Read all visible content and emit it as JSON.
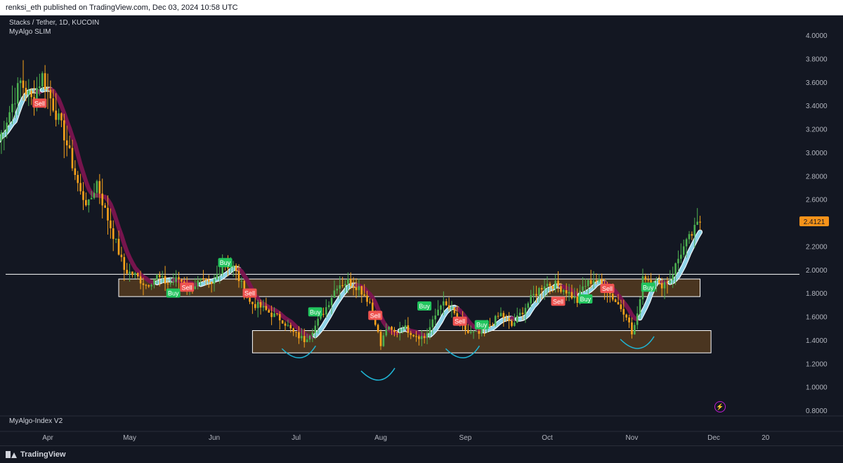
{
  "header": {
    "publisher_text": "renksi_eth published on TradingView.com, Dec 03, 2024 10:58 UTC"
  },
  "legend": {
    "symbol": "Stacks / Tether, 1D, KUCOIN",
    "indicator1": "MyAlgo SLIM",
    "indicator2": "MyAlgo-Index V2"
  },
  "footer": {
    "brand": "TradingView"
  },
  "icons": {
    "alert": "bolt-icon",
    "logo": "tradingview-logo-icon"
  },
  "colors": {
    "background": "#131722",
    "bull_candle": "#4caf50",
    "bear_candle": "#f7a21b",
    "up_band": "#8fd3e8",
    "down_band": "#7b1450",
    "zone_fill": "#4a3520",
    "zone_border": "#ffffff",
    "buy_label": "#22c55e",
    "sell_label": "#ef5350",
    "price_tag": "#f7931a",
    "hand_curves": "#1fb6d6"
  },
  "chart_data": {
    "type": "candlestick",
    "y_ticks": [
      "4.0000",
      "3.8000",
      "3.6000",
      "3.4000",
      "3.2000",
      "3.0000",
      "2.8000",
      "2.6000",
      "2.4000",
      "2.2000",
      "2.0000",
      "1.8000",
      "1.6000",
      "1.4000",
      "1.2000",
      "1.0000",
      "0.8000"
    ],
    "ylim": [
      0.8,
      4.0
    ],
    "x_ticks": [
      {
        "label": "Apr",
        "day": 18
      },
      {
        "label": "May",
        "day": 48
      },
      {
        "label": "Jun",
        "day": 79
      },
      {
        "label": "Jul",
        "day": 109
      },
      {
        "label": "Aug",
        "day": 140
      },
      {
        "label": "Sep",
        "day": 171
      },
      {
        "label": "Oct",
        "day": 201
      },
      {
        "label": "Nov",
        "day": 232
      },
      {
        "label": "Dec",
        "day": 262
      },
      {
        "label": "20",
        "day": 281
      }
    ],
    "last_price": "2.4121",
    "horizontal_line": 1.96,
    "zones": [
      {
        "from_day": 44,
        "to_day": 257,
        "low": 1.77,
        "high": 1.92
      },
      {
        "from_day": 93,
        "to_day": 261,
        "low": 1.29,
        "high": 1.48
      }
    ],
    "price_path": [
      [
        0,
        3.1
      ],
      [
        4,
        3.35
      ],
      [
        8,
        3.6
      ],
      [
        12,
        3.45
      ],
      [
        16,
        3.65
      ],
      [
        20,
        3.4
      ],
      [
        24,
        3.15
      ],
      [
        27,
        2.9
      ],
      [
        30,
        2.65
      ],
      [
        33,
        2.55
      ],
      [
        36,
        2.75
      ],
      [
        39,
        2.5
      ],
      [
        42,
        2.3
      ],
      [
        46,
        2.0
      ],
      [
        50,
        1.95
      ],
      [
        54,
        1.87
      ],
      [
        58,
        1.94
      ],
      [
        62,
        1.88
      ],
      [
        66,
        1.92
      ],
      [
        70,
        1.85
      ],
      [
        74,
        1.9
      ],
      [
        78,
        1.86
      ],
      [
        82,
        2.05
      ],
      [
        86,
        2.02
      ],
      [
        89,
        1.87
      ],
      [
        92,
        1.72
      ],
      [
        96,
        1.68
      ],
      [
        100,
        1.62
      ],
      [
        104,
        1.57
      ],
      [
        108,
        1.46
      ],
      [
        112,
        1.4
      ],
      [
        116,
        1.52
      ],
      [
        120,
        1.68
      ],
      [
        124,
        1.87
      ],
      [
        128,
        1.9
      ],
      [
        132,
        1.85
      ],
      [
        136,
        1.72
      ],
      [
        138,
        1.56
      ],
      [
        140,
        1.35
      ],
      [
        142,
        1.5
      ],
      [
        145,
        1.46
      ],
      [
        148,
        1.52
      ],
      [
        152,
        1.45
      ],
      [
        156,
        1.42
      ],
      [
        159,
        1.55
      ],
      [
        162,
        1.72
      ],
      [
        166,
        1.65
      ],
      [
        170,
        1.52
      ],
      [
        172,
        1.46
      ],
      [
        176,
        1.45
      ],
      [
        180,
        1.53
      ],
      [
        184,
        1.62
      ],
      [
        188,
        1.52
      ],
      [
        192,
        1.65
      ],
      [
        196,
        1.78
      ],
      [
        200,
        1.88
      ],
      [
        204,
        1.87
      ],
      [
        208,
        1.82
      ],
      [
        212,
        1.73
      ],
      [
        214,
        1.85
      ],
      [
        218,
        1.92
      ],
      [
        222,
        1.86
      ],
      [
        226,
        1.73
      ],
      [
        230,
        1.62
      ],
      [
        232,
        1.45
      ],
      [
        234,
        1.6
      ],
      [
        236,
        1.95
      ],
      [
        238,
        1.92
      ],
      [
        240,
        1.93
      ],
      [
        242,
        1.86
      ],
      [
        246,
        1.92
      ],
      [
        250,
        2.15
      ],
      [
        254,
        2.3
      ],
      [
        256,
        2.38
      ],
      [
        257,
        2.41
      ]
    ],
    "signals": [
      {
        "label": "Sell",
        "day": 15,
        "price": 3.42
      },
      {
        "label": "Buy",
        "day": 64,
        "price": 1.8
      },
      {
        "label": "Sell",
        "day": 69,
        "price": 1.85
      },
      {
        "label": "Buy",
        "day": 83,
        "price": 2.06
      },
      {
        "label": "Sell",
        "day": 92,
        "price": 1.8
      },
      {
        "label": "Buy",
        "day": 116,
        "price": 1.64
      },
      {
        "label": "Sell",
        "day": 138,
        "price": 1.61
      },
      {
        "label": "Buy",
        "day": 156,
        "price": 1.69
      },
      {
        "label": "Sell",
        "day": 169,
        "price": 1.56
      },
      {
        "label": "Buy",
        "day": 177,
        "price": 1.53
      },
      {
        "label": "Sell",
        "day": 205,
        "price": 1.73
      },
      {
        "label": "Buy",
        "day": 215,
        "price": 1.75
      },
      {
        "label": "Sell",
        "day": 223,
        "price": 1.84
      },
      {
        "label": "Buy",
        "day": 238,
        "price": 1.85
      }
    ]
  }
}
